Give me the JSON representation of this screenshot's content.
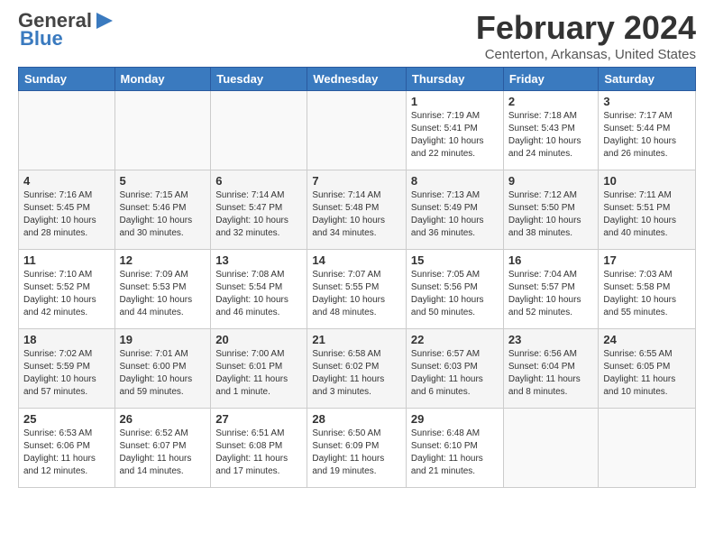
{
  "header": {
    "logo_general": "General",
    "logo_blue": "Blue",
    "month_title": "February 2024",
    "location": "Centerton, Arkansas, United States"
  },
  "calendar": {
    "days_of_week": [
      "Sunday",
      "Monday",
      "Tuesday",
      "Wednesday",
      "Thursday",
      "Friday",
      "Saturday"
    ],
    "weeks": [
      [
        {
          "day": "",
          "info": ""
        },
        {
          "day": "",
          "info": ""
        },
        {
          "day": "",
          "info": ""
        },
        {
          "day": "",
          "info": ""
        },
        {
          "day": "1",
          "info": "Sunrise: 7:19 AM\nSunset: 5:41 PM\nDaylight: 10 hours\nand 22 minutes."
        },
        {
          "day": "2",
          "info": "Sunrise: 7:18 AM\nSunset: 5:43 PM\nDaylight: 10 hours\nand 24 minutes."
        },
        {
          "day": "3",
          "info": "Sunrise: 7:17 AM\nSunset: 5:44 PM\nDaylight: 10 hours\nand 26 minutes."
        }
      ],
      [
        {
          "day": "4",
          "info": "Sunrise: 7:16 AM\nSunset: 5:45 PM\nDaylight: 10 hours\nand 28 minutes."
        },
        {
          "day": "5",
          "info": "Sunrise: 7:15 AM\nSunset: 5:46 PM\nDaylight: 10 hours\nand 30 minutes."
        },
        {
          "day": "6",
          "info": "Sunrise: 7:14 AM\nSunset: 5:47 PM\nDaylight: 10 hours\nand 32 minutes."
        },
        {
          "day": "7",
          "info": "Sunrise: 7:14 AM\nSunset: 5:48 PM\nDaylight: 10 hours\nand 34 minutes."
        },
        {
          "day": "8",
          "info": "Sunrise: 7:13 AM\nSunset: 5:49 PM\nDaylight: 10 hours\nand 36 minutes."
        },
        {
          "day": "9",
          "info": "Sunrise: 7:12 AM\nSunset: 5:50 PM\nDaylight: 10 hours\nand 38 minutes."
        },
        {
          "day": "10",
          "info": "Sunrise: 7:11 AM\nSunset: 5:51 PM\nDaylight: 10 hours\nand 40 minutes."
        }
      ],
      [
        {
          "day": "11",
          "info": "Sunrise: 7:10 AM\nSunset: 5:52 PM\nDaylight: 10 hours\nand 42 minutes."
        },
        {
          "day": "12",
          "info": "Sunrise: 7:09 AM\nSunset: 5:53 PM\nDaylight: 10 hours\nand 44 minutes."
        },
        {
          "day": "13",
          "info": "Sunrise: 7:08 AM\nSunset: 5:54 PM\nDaylight: 10 hours\nand 46 minutes."
        },
        {
          "day": "14",
          "info": "Sunrise: 7:07 AM\nSunset: 5:55 PM\nDaylight: 10 hours\nand 48 minutes."
        },
        {
          "day": "15",
          "info": "Sunrise: 7:05 AM\nSunset: 5:56 PM\nDaylight: 10 hours\nand 50 minutes."
        },
        {
          "day": "16",
          "info": "Sunrise: 7:04 AM\nSunset: 5:57 PM\nDaylight: 10 hours\nand 52 minutes."
        },
        {
          "day": "17",
          "info": "Sunrise: 7:03 AM\nSunset: 5:58 PM\nDaylight: 10 hours\nand 55 minutes."
        }
      ],
      [
        {
          "day": "18",
          "info": "Sunrise: 7:02 AM\nSunset: 5:59 PM\nDaylight: 10 hours\nand 57 minutes."
        },
        {
          "day": "19",
          "info": "Sunrise: 7:01 AM\nSunset: 6:00 PM\nDaylight: 10 hours\nand 59 minutes."
        },
        {
          "day": "20",
          "info": "Sunrise: 7:00 AM\nSunset: 6:01 PM\nDaylight: 11 hours\nand 1 minute."
        },
        {
          "day": "21",
          "info": "Sunrise: 6:58 AM\nSunset: 6:02 PM\nDaylight: 11 hours\nand 3 minutes."
        },
        {
          "day": "22",
          "info": "Sunrise: 6:57 AM\nSunset: 6:03 PM\nDaylight: 11 hours\nand 6 minutes."
        },
        {
          "day": "23",
          "info": "Sunrise: 6:56 AM\nSunset: 6:04 PM\nDaylight: 11 hours\nand 8 minutes."
        },
        {
          "day": "24",
          "info": "Sunrise: 6:55 AM\nSunset: 6:05 PM\nDaylight: 11 hours\nand 10 minutes."
        }
      ],
      [
        {
          "day": "25",
          "info": "Sunrise: 6:53 AM\nSunset: 6:06 PM\nDaylight: 11 hours\nand 12 minutes."
        },
        {
          "day": "26",
          "info": "Sunrise: 6:52 AM\nSunset: 6:07 PM\nDaylight: 11 hours\nand 14 minutes."
        },
        {
          "day": "27",
          "info": "Sunrise: 6:51 AM\nSunset: 6:08 PM\nDaylight: 11 hours\nand 17 minutes."
        },
        {
          "day": "28",
          "info": "Sunrise: 6:50 AM\nSunset: 6:09 PM\nDaylight: 11 hours\nand 19 minutes."
        },
        {
          "day": "29",
          "info": "Sunrise: 6:48 AM\nSunset: 6:10 PM\nDaylight: 11 hours\nand 21 minutes."
        },
        {
          "day": "",
          "info": ""
        },
        {
          "day": "",
          "info": ""
        }
      ]
    ]
  }
}
